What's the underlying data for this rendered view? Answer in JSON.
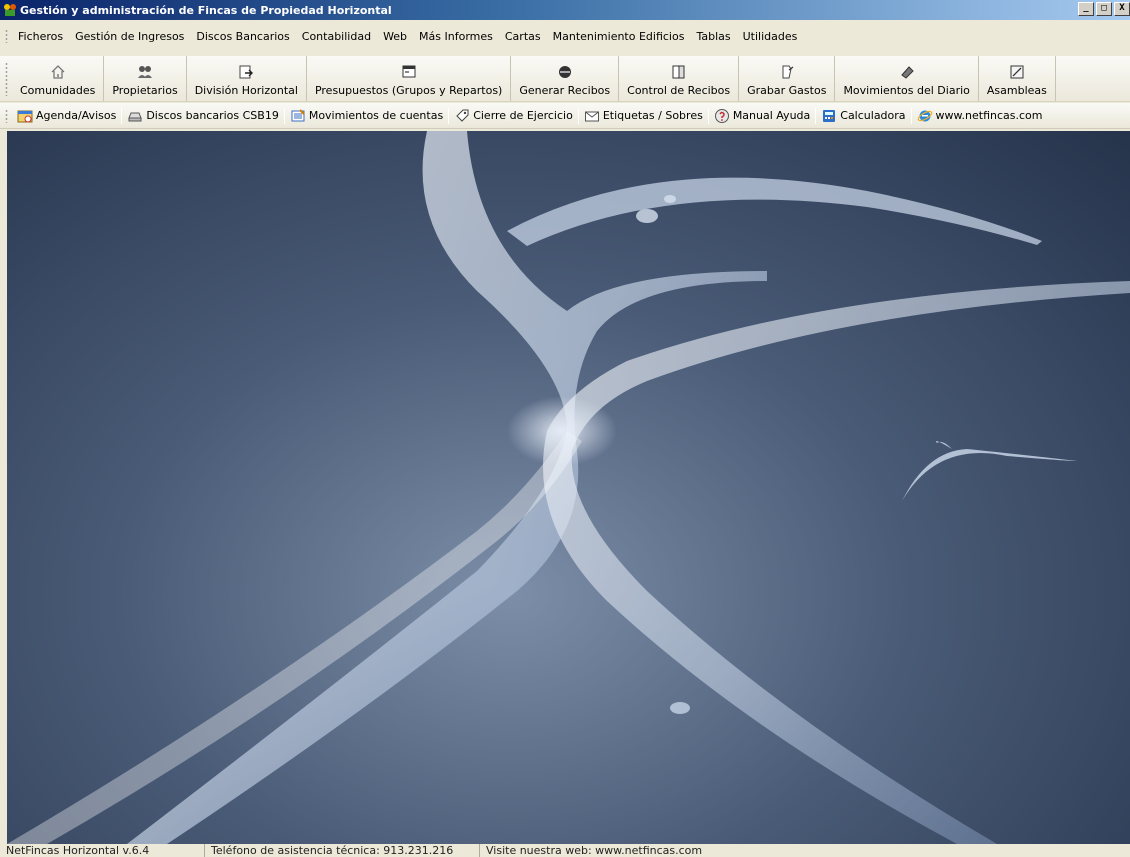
{
  "window": {
    "title": "Gestión y administración de Fincas de Propiedad Horizontal",
    "controls": {
      "minimize": "_",
      "restore": "□",
      "close": "X"
    }
  },
  "menu": [
    "Ficheros",
    "Gestión de Ingresos",
    "Discos Bancarios",
    "Contabilidad",
    "Web",
    "Más Informes",
    "Cartas",
    "Mantenimiento Edificios",
    "Tablas",
    "Utilidades"
  ],
  "toolbar": {
    "items": [
      {
        "label": "Comunidades",
        "icon": "house-icon"
      },
      {
        "label": "Propietarios",
        "icon": "people-icon"
      },
      {
        "label": "División Horizontal",
        "icon": "document-arrow-icon"
      },
      {
        "label": "Presupuestos (Grupos y Repartos)",
        "icon": "window-icon"
      },
      {
        "label": "Generar Recibos",
        "icon": "disc-icon"
      },
      {
        "label": "Control de Recibos",
        "icon": "door-icon"
      },
      {
        "label": "Grabar Gastos",
        "icon": "receipt-icon"
      },
      {
        "label": "Movimientos del Diario",
        "icon": "eraser-icon"
      },
      {
        "label": "Asambleas",
        "icon": "notepad-icon"
      }
    ]
  },
  "quickbar": {
    "items": [
      {
        "label": "Agenda/Avisos",
        "icon": "agenda-icon"
      },
      {
        "label": "Discos bancarios CSB19",
        "icon": "disk-drive-icon"
      },
      {
        "label": "Movimientos de cuentas",
        "icon": "ledger-icon"
      },
      {
        "label": "Cierre de Ejercicio",
        "icon": "tag-icon"
      },
      {
        "label": "Etiquetas / Sobres",
        "icon": "envelope-icon"
      },
      {
        "label": "Manual Ayuda",
        "icon": "help-icon"
      },
      {
        "label": "Calculadora",
        "icon": "calculator-icon"
      },
      {
        "label": "www.netfincas.com",
        "icon": "internet-explorer-icon"
      }
    ]
  },
  "status": {
    "version": "NetFincas Horizontal v.6.4",
    "phone": "Teléfono de asistencia técnica: 913.231.216",
    "web": "Visite nuestra web: www.netfincas.com"
  },
  "colors": {
    "titlebar_start": "#0a246a",
    "titlebar_end": "#a6caf0",
    "chrome": "#ece9d8",
    "desktop_dark": "#25334b",
    "desktop_light": "#7d8ea8"
  }
}
